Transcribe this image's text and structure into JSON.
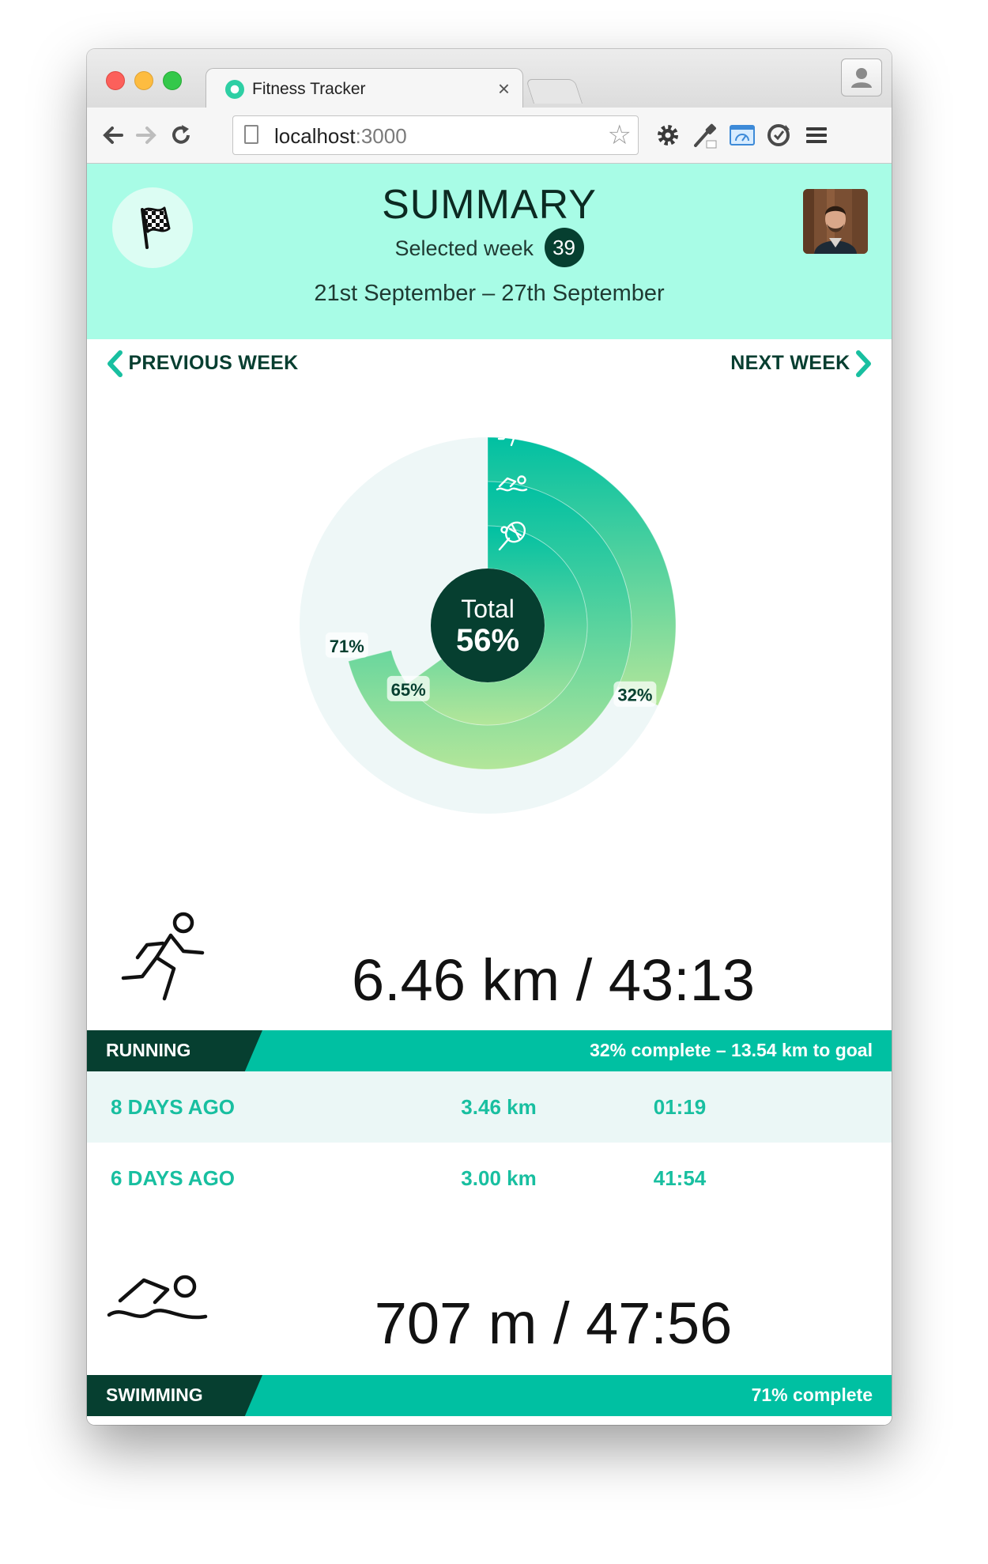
{
  "browser": {
    "tab_title": "Fitness Tracker",
    "tab_close": "×",
    "url_host": "localhost",
    "url_port": ":3000",
    "star": "☆"
  },
  "summary": {
    "title": "SUMMARY",
    "selected_week_label": "Selected week",
    "week_number": "39",
    "date_range": "21st September – 27th September"
  },
  "nav": {
    "previous": "PREVIOUS WEEK",
    "next": "NEXT WEEK"
  },
  "chart_data": {
    "type": "radial-bar",
    "center_label": "Total",
    "center_value": "56%",
    "series": [
      {
        "activity": "running",
        "value": 32,
        "label": "32%"
      },
      {
        "activity": "swimming",
        "value": 71,
        "label": "71%"
      },
      {
        "activity": "tennis",
        "value": 65,
        "label": "65%"
      }
    ],
    "colors": {
      "start": "#00c0a2",
      "end": "#b3e69a",
      "track": "#eef7f7",
      "center": "#063f30"
    }
  },
  "activities": [
    {
      "name": "RUNNING",
      "icon": "running-icon",
      "summary": "6.46 km / 43:13",
      "progress": "32% complete – 13.54 km to goal",
      "sessions": [
        {
          "when": "8 DAYS AGO",
          "distance": "3.46 km",
          "time": "01:19"
        },
        {
          "when": "6 DAYS AGO",
          "distance": "3.00 km",
          "time": "41:54"
        }
      ]
    },
    {
      "name": "SWIMMING",
      "icon": "swimming-icon",
      "summary": "707 m / 47:56",
      "progress": "71% complete"
    }
  ]
}
